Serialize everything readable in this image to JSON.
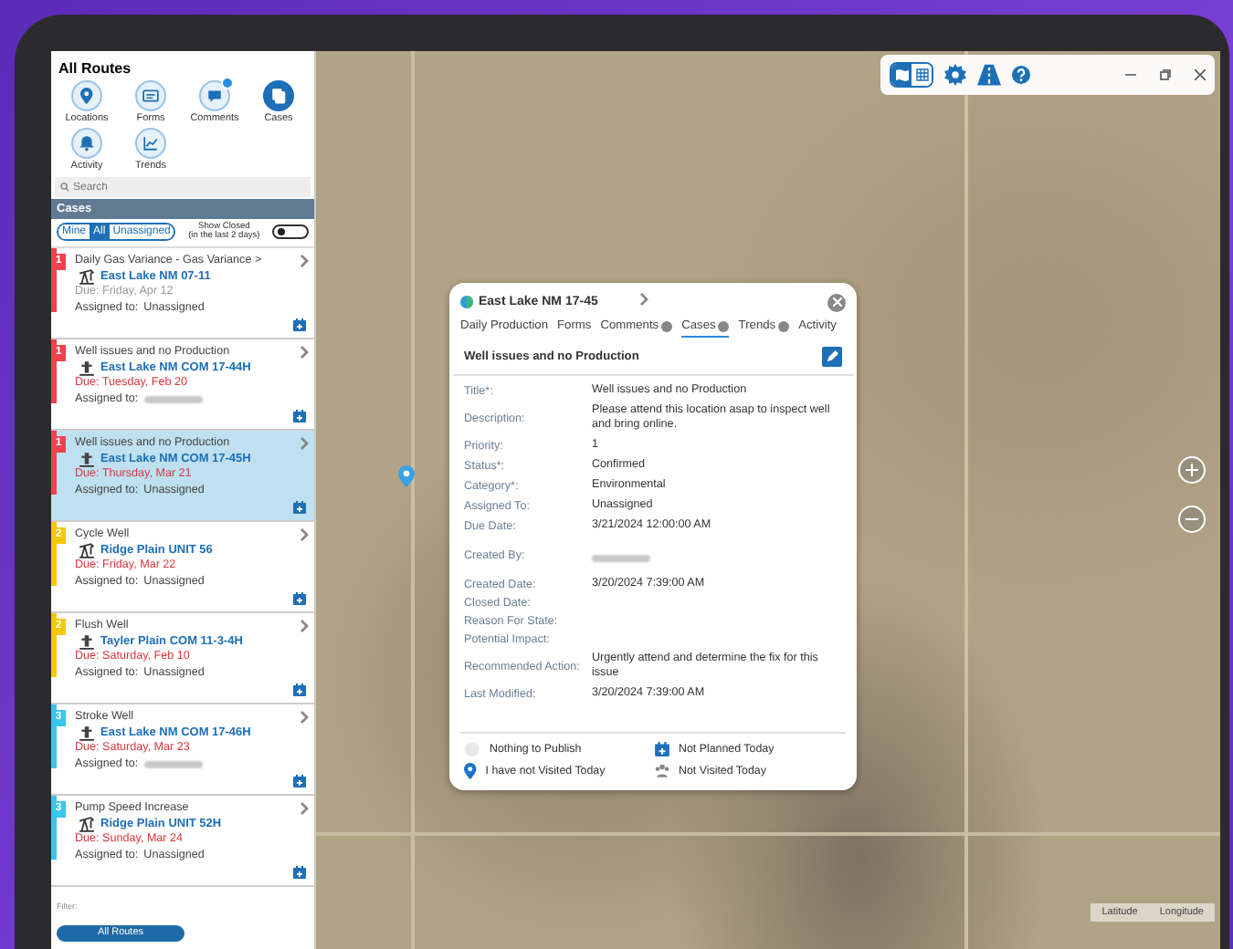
{
  "sidebar": {
    "title": "All Routes",
    "nav": [
      {
        "label": "Locations",
        "selected": false,
        "badge": false
      },
      {
        "label": "Forms",
        "selected": false,
        "badge": false
      },
      {
        "label": "Comments",
        "selected": false,
        "badge": true
      },
      {
        "label": "Cases",
        "selected": true,
        "badge": false
      },
      {
        "label": "Activity",
        "selected": false,
        "badge": false
      },
      {
        "label": "Trends",
        "selected": false,
        "badge": false
      }
    ],
    "search": {
      "placeholder": "Search"
    },
    "section": "Cases",
    "filters": [
      {
        "label": "Mine",
        "selected": false
      },
      {
        "label": "All",
        "selected": true
      },
      {
        "label": "Unassigned",
        "selected": false
      }
    ],
    "show_closed": {
      "label": "Show Closed",
      "sublabel": "(in the last 2 days)",
      "on": false
    },
    "cases": [
      {
        "priority": "1",
        "color": "#f0414d",
        "title": "Daily Gas Variance -  Gas Variance >",
        "well": "East Lake NM 07-11",
        "kind": "pumpjack",
        "due": "Due: Friday, Apr 12",
        "overdue": false,
        "assigned_label": "Assigned to:",
        "assigned": "Unassigned",
        "hidden_assignee": false,
        "selected": false
      },
      {
        "priority": "1",
        "color": "#f0414d",
        "title": "Well issues and no Production",
        "well": "East Lake NM COM 17-44H",
        "kind": "wellhead",
        "due": "Due: Tuesday, Feb 20",
        "overdue": true,
        "assigned_label": "Assigned to:",
        "hidden_assignee": true,
        "selected": false
      },
      {
        "priority": "1",
        "color": "#f0414d",
        "title": "Well issues and no Production",
        "well": "East Lake NM COM 17-45H",
        "kind": "wellhead",
        "due": "Due: Thursday, Mar 21",
        "overdue": true,
        "assigned_label": "Assigned to:",
        "assigned": "Unassigned",
        "hidden_assignee": false,
        "selected": true
      },
      {
        "priority": "2",
        "color": "#f5c800",
        "title": "Cycle Well",
        "well": "Ridge Plain UNIT 56",
        "kind": "pumpjack",
        "due": "Due: Friday, Mar 22",
        "overdue": true,
        "assigned_label": "Assigned to:",
        "assigned": "Unassigned",
        "hidden_assignee": false,
        "selected": false
      },
      {
        "priority": "2",
        "color": "#f5c800",
        "title": "Flush Well",
        "well": "Tayler Plain COM 11-3-4H",
        "kind": "wellhead",
        "due": "Due: Saturday, Feb 10",
        "overdue": true,
        "assigned_label": "Assigned to:",
        "assigned": "Unassigned",
        "hidden_assignee": false,
        "selected": false
      },
      {
        "priority": "3",
        "color": "#3cc4f0",
        "title": "Stroke Well",
        "well": "East Lake NM COM 17-46H",
        "kind": "wellhead",
        "due": "Due: Saturday, Mar 23",
        "overdue": true,
        "assigned_label": "Assigned to:",
        "hidden_assignee": true,
        "selected": false
      },
      {
        "priority": "3",
        "color": "#3cc4f0",
        "title": "Pump Speed Increase",
        "well": "Ridge Plain UNIT 52H",
        "kind": "pumpjack",
        "due": "Due: Sunday, Mar 24",
        "overdue": true,
        "assigned_label": "Assigned to:",
        "assigned": "Unassigned",
        "hidden_assignee": false,
        "selected": false
      }
    ],
    "filter_label": "Filter:",
    "route_button": "All Routes"
  },
  "map": {
    "views": [
      {
        "selected": true
      },
      {
        "selected": false
      }
    ],
    "coords": [
      "Latitude",
      "Longitude"
    ]
  },
  "popup": {
    "location": "East Lake NM 17-45",
    "tabs": [
      {
        "label": "Daily Production",
        "badge": false,
        "selected": false
      },
      {
        "label": "Forms",
        "badge": false,
        "selected": false
      },
      {
        "label": "Comments",
        "badge": true,
        "selected": false
      },
      {
        "label": "Cases",
        "badge": true,
        "selected": true
      },
      {
        "label": "Trends",
        "badge": true,
        "selected": false
      },
      {
        "label": "Activity",
        "badge": false,
        "selected": false
      }
    ],
    "case_title": "Well issues and no Production",
    "fields": [
      {
        "label": "Title*:",
        "value": "Well issues and no Production"
      },
      {
        "label": "Description:",
        "value": "Please attend this location asap to inspect well and bring online."
      },
      {
        "label": "Priority:",
        "value": "1"
      },
      {
        "label": "Status*:",
        "value": "Confirmed"
      },
      {
        "label": "Category*:",
        "value": "Environmental"
      },
      {
        "label": "Assigned To:",
        "value": "Unassigned"
      },
      {
        "label": "Due Date:",
        "value": "3/21/2024 12:00:00 AM"
      },
      {
        "label": "Created By:",
        "hidden": true
      },
      {
        "label": "Created Date:",
        "value": "3/20/2024 7:39:00 AM"
      },
      {
        "label": "Closed Date:"
      },
      {
        "label": "Reason For State:"
      },
      {
        "label": "Potential Impact:"
      },
      {
        "label": "Recommended Action:",
        "value": "Urgently attend and determine the fix for this issue"
      },
      {
        "label": "Last Modified:",
        "value": "3/20/2024 7:39:00 AM"
      }
    ],
    "legend": [
      {
        "label": "Nothing to Publish"
      },
      {
        "label": "Not Planned Today"
      },
      {
        "label": "I have not Visited Today"
      },
      {
        "label": "Not Visited Today"
      }
    ]
  }
}
